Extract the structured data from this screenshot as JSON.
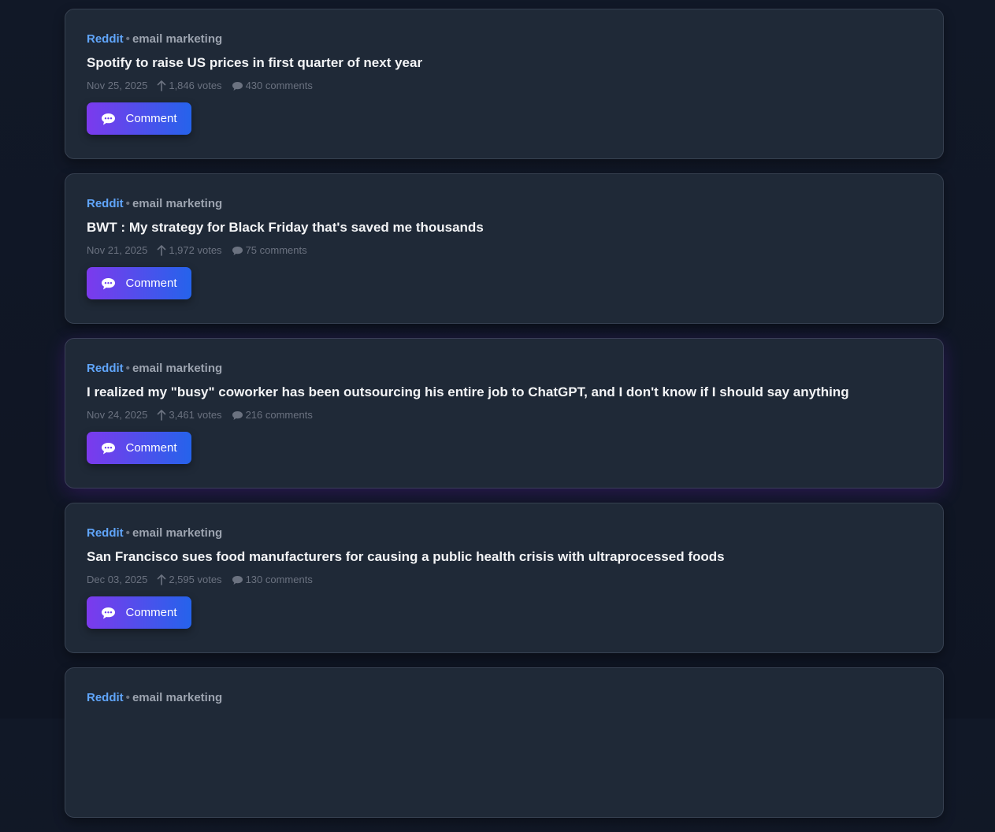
{
  "posts": [
    {
      "source": "Reddit",
      "separator": "•",
      "topic": "email marketing",
      "title": "Spotify to raise US prices in first quarter of next year",
      "date": "Nov 25, 2025",
      "votes": "1,846 votes",
      "comments": "430 comments",
      "button_label": "Comment"
    },
    {
      "source": "Reddit",
      "separator": "•",
      "topic": "email marketing",
      "title": "BWT : My strategy for Black Friday that's saved me thousands",
      "date": "Nov 21, 2025",
      "votes": "1,972 votes",
      "comments": "75 comments",
      "button_label": "Comment"
    },
    {
      "source": "Reddit",
      "separator": "•",
      "topic": "email marketing",
      "title": "I realized my \"busy\" coworker has been outsourcing his entire job to ChatGPT, and I don't know if I should say anything",
      "date": "Nov 24, 2025",
      "votes": "3,461 votes",
      "comments": "216 comments",
      "button_label": "Comment",
      "highlighted": true
    },
    {
      "source": "Reddit",
      "separator": "•",
      "topic": "email marketing",
      "title": "San Francisco sues food manufacturers for causing a public health crisis with ultraprocessed foods",
      "date": "Dec 03, 2025",
      "votes": "2,595 votes",
      "comments": "130 comments",
      "button_label": "Comment"
    },
    {
      "source": "Reddit",
      "separator": "•",
      "topic": "email marketing"
    }
  ],
  "icons": {
    "vote": "arrow-up-icon",
    "comments": "speech-bubble-icon",
    "button": "chat-bubble-icon"
  },
  "colors": {
    "background": "#111827",
    "card": "#1f2937",
    "source": "#60a5fa",
    "button_gradient_start": "#7c3aed",
    "button_gradient_end": "#2563eb"
  }
}
